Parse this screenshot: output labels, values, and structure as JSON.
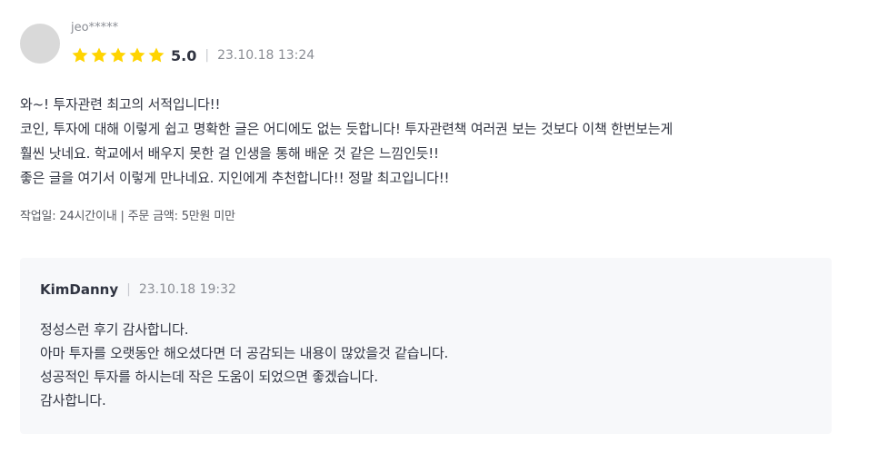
{
  "review": {
    "username": "jeo*****",
    "rating_value": 5,
    "rating_max": 5,
    "score_label": "5.0",
    "separator": "|",
    "date": "23.10.18 13:24",
    "body_lines": [
      "와~! 투자관련 최고의 서적입니다!!",
      "코인, 투자에 대해 이렇게 쉽고 명확한 글은 어디에도 없는 듯합니다! 투자관련책 여러권 보는 것보다 이책 한번보는게",
      "훨씬 낫네요. 학교에서 배우지 못한 걸 인생을 통해 배운 것 같은 느낌인듯!!",
      "좋은 글을 여기서 이렇게 만나네요. 지인에게 추천합니다!! 정말 최고입니다!!"
    ],
    "order_info": "작업일: 24시간이내 | 주문 금액: 5만원 미만"
  },
  "reply": {
    "author": "KimDanny",
    "separator": "|",
    "date": "23.10.18 19:32",
    "body_lines": [
      "정성스런 후기 감사합니다.",
      "아마 투자를 오랫동안 해오셨다면 더 공감되는 내용이 많았을것 같습니다.",
      "성공적인 투자를 하시는데 작은 도움이 되었으면 좋겠습니다.",
      "감사합니다."
    ]
  },
  "colors": {
    "star": "#FFD400",
    "avatar": "#D9D9D9",
    "reply_background": "#F7F8FA",
    "text_primary": "#303441",
    "text_secondary": "#8A8D94"
  },
  "icons": {
    "star": "star-icon"
  }
}
